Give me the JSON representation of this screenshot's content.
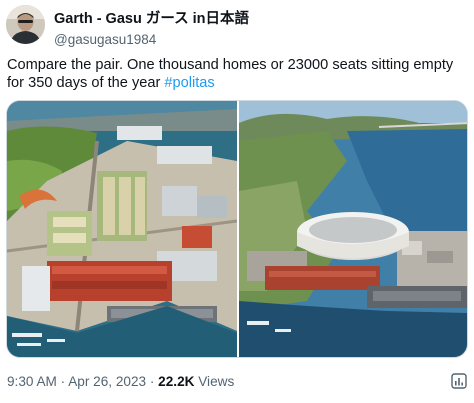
{
  "tweet": {
    "display_name": "Garth - Gasu ガース in日本語",
    "handle": "@gasugasu1984",
    "text_main": "Compare the pair.   One thousand homes or 23000 seats sitting empty for 350 days of the year ",
    "hashtag": "#politas",
    "time": "9:30 AM",
    "sep1": " · ",
    "date": "Apr 26, 2023",
    "sep2": " · ",
    "views_count": "22.2K",
    "views_label": " Views"
  },
  "colors": {
    "link": "#1d9bf0",
    "secondary_text": "#536471",
    "border": "#cfd9de"
  },
  "icons": {
    "analytics": "analytics-icon"
  }
}
